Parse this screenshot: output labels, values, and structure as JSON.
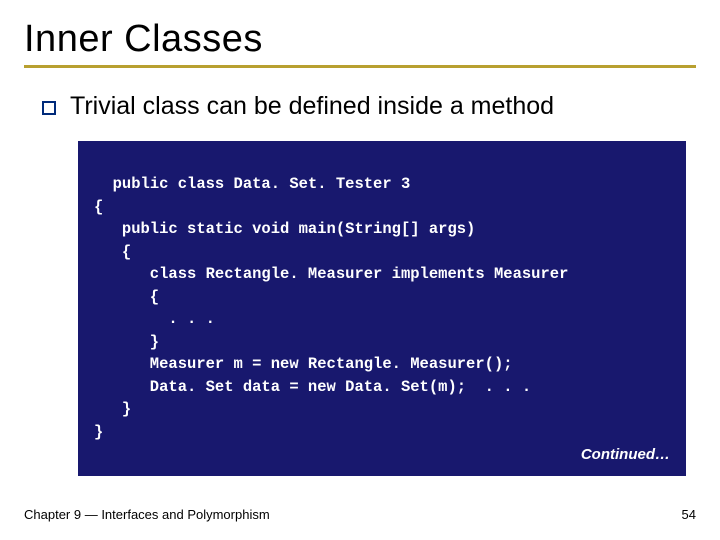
{
  "title": "Inner Classes",
  "bullet": "Trivial class can be defined inside a method",
  "code": "public class Data. Set. Tester 3\n{\n   public static void main(String[] args)\n   {\n      class Rectangle. Measurer implements Measurer\n      {\n        . . .\n      }\n      Measurer m = new Rectangle. Measurer();\n      Data. Set data = new Data. Set(m);  . . .\n   }\n}",
  "continued": "Continued…",
  "footer": {
    "left": "Chapter 9 — Interfaces and Polymorphism",
    "right": "54"
  }
}
